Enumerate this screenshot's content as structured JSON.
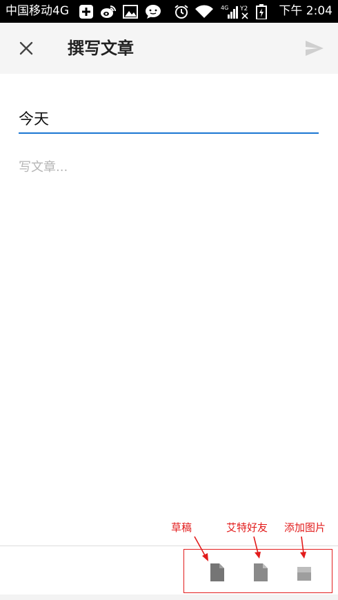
{
  "status_bar": {
    "carrier": "中国移动4G",
    "time": "下午 2:04",
    "network_label": "4G",
    "sim2_label": "Y2",
    "icons": [
      "add-icon",
      "weibo-icon",
      "image-icon",
      "chat-icon",
      "alarm-icon",
      "wifi-icon",
      "signal-icon",
      "battery-icon"
    ]
  },
  "app_bar": {
    "title": "撰写文章",
    "close_icon": "close-icon",
    "send_icon": "send-icon"
  },
  "editor": {
    "title_value": "今天",
    "body_placeholder": "写文章..."
  },
  "toolbar": {
    "buttons": [
      {
        "name": "draft",
        "icon": "document-icon",
        "annotation": "草稿"
      },
      {
        "name": "mention-friends",
        "icon": "document-icon",
        "annotation": "艾特好友"
      },
      {
        "name": "add-image",
        "icon": "image-icon",
        "annotation": "添加图片"
      }
    ]
  },
  "colors": {
    "status_bar_bg": "#000000",
    "app_bar_bg": "#f5f5f5",
    "accent": "#1976d2",
    "annotation": "#e21b1b",
    "icon_gray": "#757575"
  }
}
